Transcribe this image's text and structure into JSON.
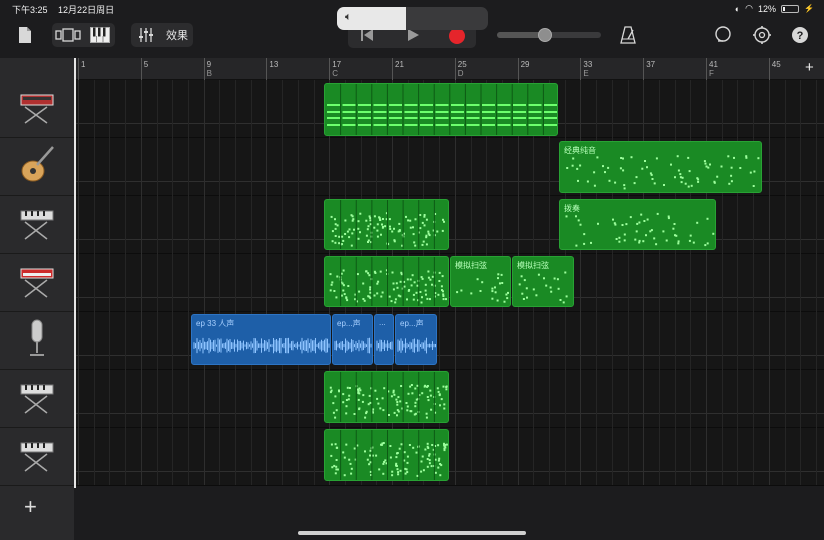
{
  "status": {
    "time": "下午3:25",
    "date": "12月22日周日",
    "battery": "12%"
  },
  "toolbar": {
    "fx_label": "效果",
    "volume_level": 0.46,
    "tempo_slider": 0.46
  },
  "ruler": {
    "marks": [
      {
        "num": "1",
        "section": ""
      },
      {
        "num": "5",
        "section": ""
      },
      {
        "num": "9",
        "section": "B"
      },
      {
        "num": "13",
        "section": ""
      },
      {
        "num": "17",
        "section": "C"
      },
      {
        "num": "21",
        "section": ""
      },
      {
        "num": "25",
        "section": "D"
      },
      {
        "num": "29",
        "section": ""
      },
      {
        "num": "33",
        "section": "E"
      },
      {
        "num": "37",
        "section": ""
      },
      {
        "num": "41",
        "section": "F"
      },
      {
        "num": "45",
        "section": ""
      }
    ]
  },
  "tracks": [
    {
      "icon": "synth-icon",
      "color": "#c44"
    },
    {
      "icon": "guitar-icon",
      "color": "#d9a45a"
    },
    {
      "icon": "keyboard-icon",
      "color": "#aaa"
    },
    {
      "icon": "red-keyboard-icon",
      "color": "#c33"
    },
    {
      "icon": "microphone-icon",
      "color": "#ccc"
    },
    {
      "icon": "keyboard-icon",
      "color": "#aaa"
    },
    {
      "icon": "keyboard-icon",
      "color": "#aaa"
    }
  ],
  "regions": {
    "clean_tone": "经典纯音",
    "pluck": "拨奏",
    "analog_sweep_1": "模拟扫弦",
    "analog_sweep_2": "模拟扫弦",
    "vocal_main": "ep 33 人声",
    "vocal_b": "ep...声",
    "vocal_c": "...",
    "vocal_d": "ep...声"
  },
  "colors": {
    "midi_region": "#1a8a24",
    "audio_region": "#1e5fa8",
    "record": "#e5252b"
  }
}
